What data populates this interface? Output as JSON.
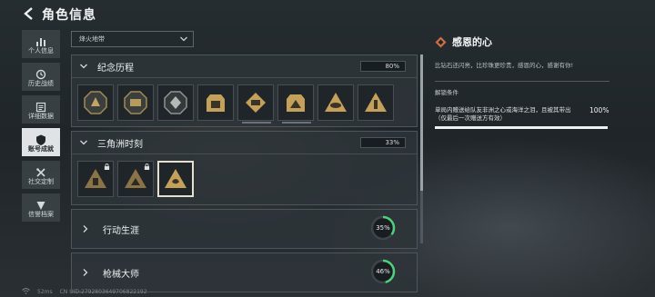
{
  "header": {
    "title": "角色信息"
  },
  "sidebar": {
    "items": [
      {
        "label": "个人信息",
        "icon": "bar-chart-icon",
        "active": false
      },
      {
        "label": "历史战绩",
        "icon": "clock-icon",
        "active": false
      },
      {
        "label": "详细数据",
        "icon": "document-icon",
        "active": false
      },
      {
        "label": "账号成就",
        "icon": "shield-icon",
        "active": true
      },
      {
        "label": "社交定制",
        "icon": "tools-icon",
        "active": false
      },
      {
        "label": "信誉档案",
        "icon": "heart-shield-icon",
        "active": false
      }
    ]
  },
  "filter": {
    "value": "烽火地带"
  },
  "sections": {
    "memorial": {
      "title": "纪念历程",
      "progress": "80%"
    },
    "delta": {
      "title": "三角洲时刻",
      "progress": "33%"
    },
    "career": {
      "title": "行动生涯",
      "progress": "35%",
      "progress_value": 0.35
    },
    "gunsmith": {
      "title": "枪械大师",
      "progress": "46%",
      "progress_value": 0.46
    }
  },
  "detail": {
    "title": "感恩的心",
    "description": "比钻石还闪亮，比珍珠更珍贵，感恩的心，感谢有你!",
    "condition_label": "解锁条件",
    "condition_text": "单局内赠送给队友非洲之心或海洋之泪，且被其带出（仅最后一次赠送方有效）",
    "condition_progress": "100%",
    "condition_progress_value": 1.0
  },
  "footer": {
    "ping": "52ms",
    "uid": "CN UID:2792803649706822192"
  },
  "colors": {
    "accent": "#c9714a",
    "ring": "#4fd07a"
  }
}
